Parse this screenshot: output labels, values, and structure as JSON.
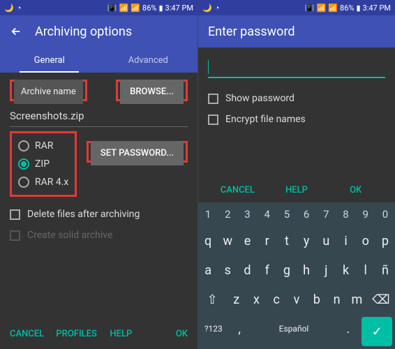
{
  "statusbar": {
    "battery": "86%",
    "time": "3:47 PM"
  },
  "left": {
    "title": "Archiving options",
    "tabs": {
      "general": "General",
      "advanced": "Advanced"
    },
    "archive_name_label": "Archive name",
    "browse": "BROWSE...",
    "filename": "Screenshots.zip",
    "formats": {
      "rar": "RAR",
      "zip": "ZIP",
      "rar4x": "RAR 4.x"
    },
    "set_password": "SET PASSWORD...",
    "delete_after": "Delete files after archiving",
    "solid_archive": "Create solid archive",
    "footer": {
      "cancel": "CANCEL",
      "profiles": "PROFILES",
      "help": "HELP",
      "ok": "OK"
    }
  },
  "right": {
    "title": "Enter password",
    "show_password": "Show password",
    "encrypt_names": "Encrypt file names",
    "actions": {
      "cancel": "CANCEL",
      "help": "HELP",
      "ok": "OK"
    },
    "keyboard": {
      "numbers": [
        "1",
        "2",
        "3",
        "4",
        "5",
        "6",
        "7",
        "8",
        "9",
        "0"
      ],
      "row1": [
        "q",
        "w",
        "e",
        "r",
        "t",
        "y",
        "u",
        "i",
        "o",
        "p"
      ],
      "row2": [
        "a",
        "s",
        "d",
        "f",
        "g",
        "h",
        "j",
        "k",
        "l",
        "ñ"
      ],
      "row3": [
        "z",
        "x",
        "c",
        "v",
        "b",
        "n",
        "m"
      ],
      "sym": "?123",
      "lang": "Español"
    }
  }
}
